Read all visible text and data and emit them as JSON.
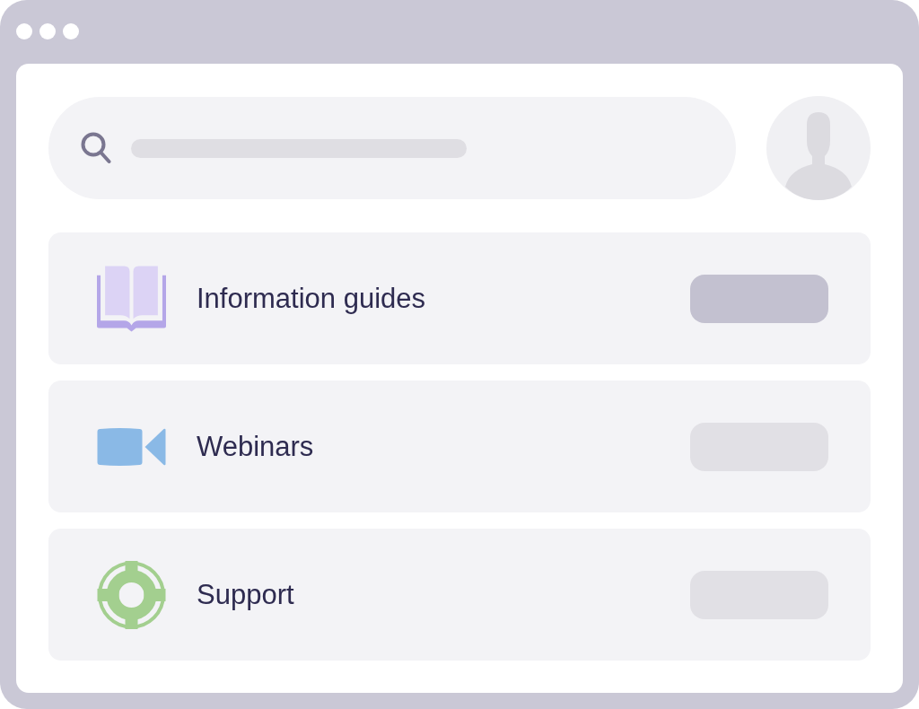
{
  "items": [
    {
      "kind": "book",
      "label": "Information guides",
      "selected": true
    },
    {
      "kind": "video",
      "label": "Webinars",
      "selected": false
    },
    {
      "kind": "lifebuoy",
      "label": "Support",
      "selected": false
    }
  ]
}
